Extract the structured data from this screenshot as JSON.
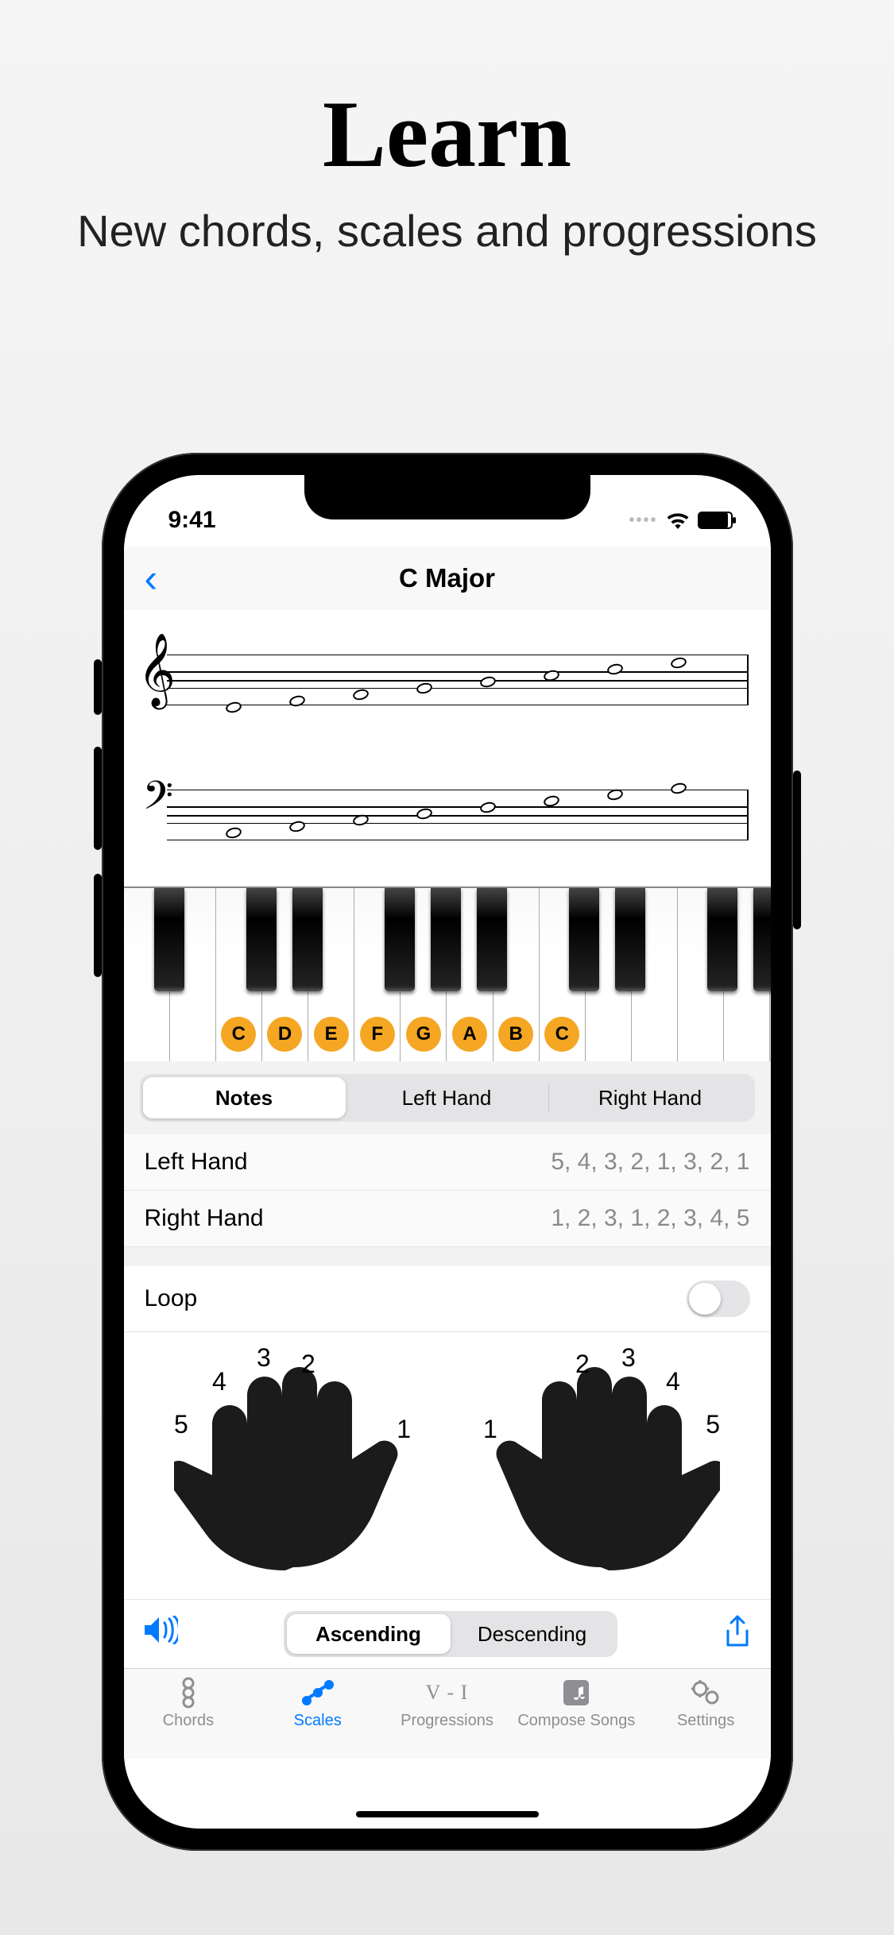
{
  "marketing": {
    "title": "Learn",
    "subtitle": "New chords, scales and progressions"
  },
  "status": {
    "time": "9:41"
  },
  "nav": {
    "title": "C Major"
  },
  "keyboard": {
    "highlighted_notes": [
      "C",
      "D",
      "E",
      "F",
      "G",
      "A",
      "B",
      "C"
    ]
  },
  "view_segments": {
    "items": [
      "Notes",
      "Left Hand",
      "Right Hand"
    ],
    "active": 0
  },
  "fingering": {
    "left_label": "Left Hand",
    "left_value": "5, 4, 3, 2, 1, 3, 2, 1",
    "right_label": "Right Hand",
    "right_value": "1, 2, 3, 1, 2, 3, 4, 5"
  },
  "loop": {
    "label": "Loop",
    "on": false
  },
  "hand_numbers": {
    "left": {
      "n1": "1",
      "n2": "2",
      "n3": "3",
      "n4": "4",
      "n5": "5"
    },
    "right": {
      "n1": "1",
      "n2": "2",
      "n3": "3",
      "n4": "4",
      "n5": "5"
    }
  },
  "direction_segments": {
    "items": [
      "Ascending",
      "Descending"
    ],
    "active": 0
  },
  "tabs": {
    "items": [
      "Chords",
      "Scales",
      "Progressions",
      "Compose Songs",
      "Settings"
    ],
    "active": 1,
    "prog_icon_text": "V - I"
  }
}
